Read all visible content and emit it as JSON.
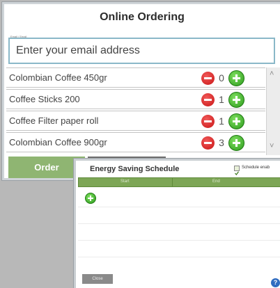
{
  "ordering": {
    "title": "Online Ordering",
    "email_label": "Email / Email",
    "email_placeholder": "Enter your email address",
    "products": [
      {
        "name": "Colombian Coffee 450gr",
        "quantity": "0"
      },
      {
        "name": "Coffee Sticks 200",
        "quantity": "1"
      },
      {
        "name": "Coffee Filter paper roll",
        "quantity": "1"
      },
      {
        "name": "Colombian Coffee 900gr",
        "quantity": "3"
      }
    ],
    "order_label": "Order",
    "colors": {
      "order_button": "#8fb572",
      "minus": "#d41c1c",
      "plus": "#2c9a1c"
    }
  },
  "schedule": {
    "title": "Energy Saving Schedule",
    "checkbox_label": "Schedule enab",
    "checkbox_checked": true,
    "columns": [
      "Start",
      "End"
    ],
    "close_label": "Close",
    "help_label": "?",
    "colors": {
      "header": "#7da656"
    }
  },
  "icons": {
    "minus": "minus-circle-icon",
    "plus": "plus-circle-icon",
    "scroll_up": "chevron-up-icon",
    "scroll_down": "chevron-down-icon",
    "help": "help-icon"
  }
}
